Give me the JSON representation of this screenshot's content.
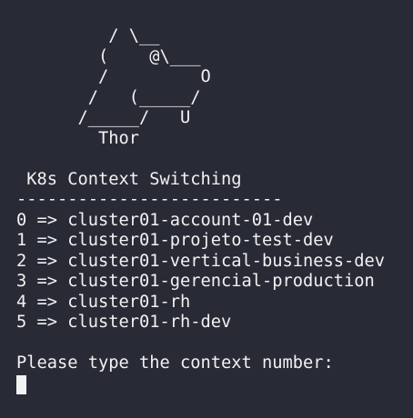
{
  "ascii_art": [
    "         / \\__",
    "        (    @\\___",
    "        /         O",
    "       /   (_____/",
    "      /_____/   U",
    "        Thor"
  ],
  "title": " K8s Context Switching",
  "separator": "--------------------------",
  "contexts": [
    "0 => cluster01-account-01-dev",
    "1 => cluster01-projeto-test-dev",
    "2 => cluster01-vertical-business-dev",
    "3 => cluster01-gerencial-production",
    "4 => cluster01-rh",
    "5 => cluster01-rh-dev"
  ],
  "prompt": "Please type the context number:",
  "colors": {
    "background": "#282a36",
    "foreground": "#f2f2f2"
  }
}
